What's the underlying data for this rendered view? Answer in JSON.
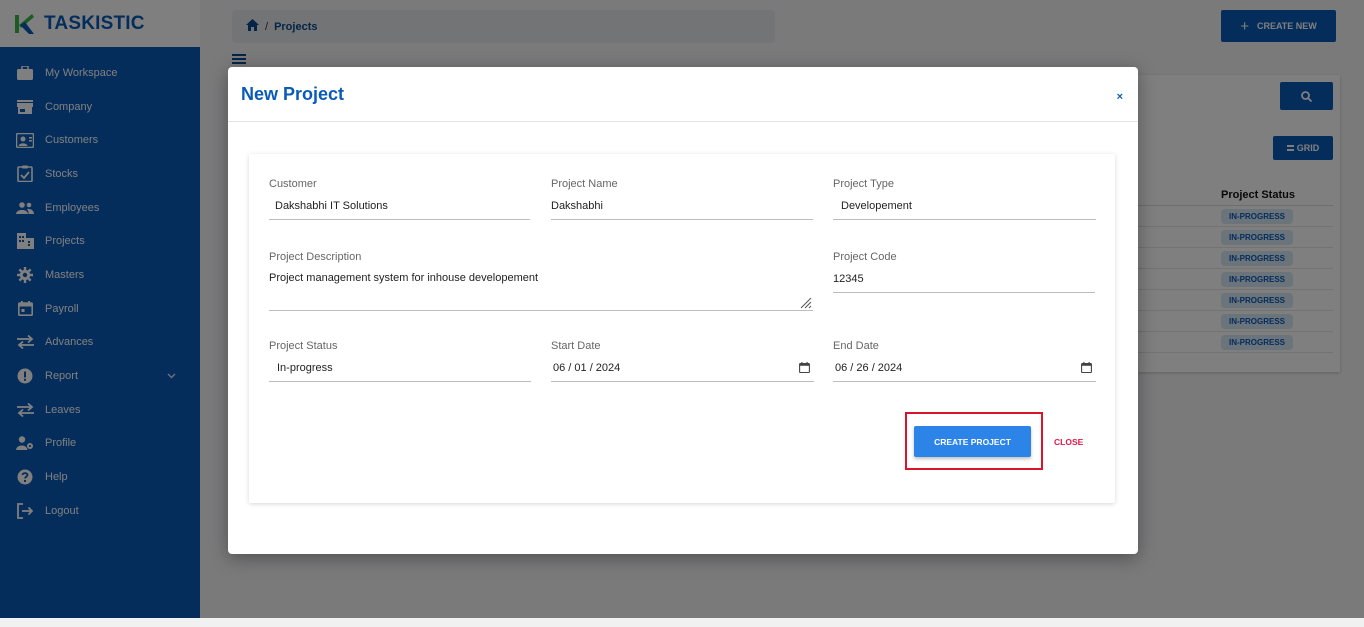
{
  "brand": {
    "name": "TASKISTIC"
  },
  "sidebar": {
    "items": [
      {
        "label": "My Workspace",
        "icon": "briefcase-icon"
      },
      {
        "label": "Company",
        "icon": "store-icon"
      },
      {
        "label": "Customers",
        "icon": "contact-card-icon"
      },
      {
        "label": "Stocks",
        "icon": "clipboard-check-icon"
      },
      {
        "label": "Employees",
        "icon": "people-icon"
      },
      {
        "label": "Projects",
        "icon": "building-icon"
      },
      {
        "label": "Masters",
        "icon": "gear-icon"
      },
      {
        "label": "Payroll",
        "icon": "calendar-icon"
      },
      {
        "label": "Advances",
        "icon": "swap-arrows-icon"
      },
      {
        "label": "Report",
        "icon": "alert-circle-icon"
      },
      {
        "label": "Leaves",
        "icon": "swap-arrows-icon"
      },
      {
        "label": "Profile",
        "icon": "user-gear-icon"
      },
      {
        "label": "Help",
        "icon": "help-circle-icon"
      },
      {
        "label": "Logout",
        "icon": "logout-icon"
      }
    ]
  },
  "header": {
    "breadcrumb": {
      "current": "Projects",
      "separator": "/"
    },
    "create_new_label": "CREATE NEW"
  },
  "background_panel": {
    "grid_label": "GRID",
    "status_header": "Project Status",
    "statuses": [
      "IN-PROGRESS",
      "IN-PROGRESS",
      "IN-PROGRESS",
      "IN-PROGRESS",
      "IN-PROGRESS",
      "IN-PROGRESS",
      "IN-PROGRESS"
    ]
  },
  "modal": {
    "title": "New Project",
    "close_symbol": "×",
    "fields": {
      "customer": {
        "label": "Customer",
        "value": "Dakshabhi IT Solutions"
      },
      "project_name": {
        "label": "Project Name",
        "value": "Dakshabhi"
      },
      "project_type": {
        "label": "Project Type",
        "value": "Developement"
      },
      "project_description": {
        "label": "Project Description",
        "value": "Project management system for inhouse developement"
      },
      "project_code": {
        "label": "Project Code",
        "value": "12345"
      },
      "project_status": {
        "label": "Project Status",
        "value": "In-progress"
      },
      "start_date": {
        "label": "Start Date",
        "value": "06 / 01 / 2024"
      },
      "end_date": {
        "label": "End Date",
        "value": "06 / 26 / 2024"
      }
    },
    "create_button_label": "CREATE PROJECT",
    "close_button_label": "CLOSE"
  },
  "colors": {
    "brand_blue": "#0a5bb7",
    "primary_button": "#2c84e8",
    "close_link": "#e0194a",
    "highlight_border": "#d9142b"
  }
}
